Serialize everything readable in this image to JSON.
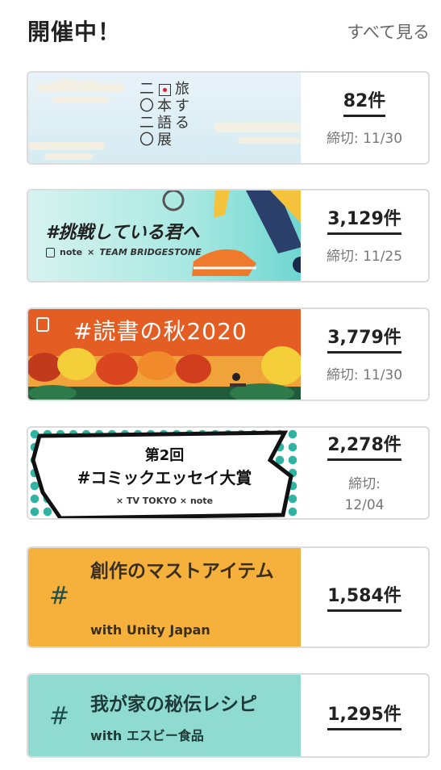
{
  "header": {
    "title": "開催中！",
    "see_all": "すべて見る"
  },
  "contests": [
    {
      "banner": {
        "grid": [
          [
            "二",
            "",
            "旅"
          ],
          [
            "〇",
            "本",
            "す"
          ],
          [
            "二",
            "語",
            "る"
          ],
          [
            "〇",
            "展",
            ""
          ]
        ]
      },
      "count": "82件",
      "deadline": "締切: 11/30"
    },
    {
      "banner": {
        "hashtag": "#挑戦している君へ",
        "logo_note": "note",
        "cross": "×",
        "partner": "TEAM BRIDGESTONE"
      },
      "count": "3,129件",
      "deadline": "締切: 11/25"
    },
    {
      "banner": {
        "hashtag": "#読書の秋2020"
      },
      "count": "3,779件",
      "deadline": "締切: 11/30"
    },
    {
      "banner": {
        "line1": "第2回",
        "line2": "#コミックエッセイ大賞",
        "logos": "×  TV TOKYO  ×  note"
      },
      "count": "2,278件",
      "deadline_label": "締切:",
      "deadline_date": "12/04"
    },
    {
      "banner": {
        "hash": "#",
        "title": "創作のマストアイテム",
        "subtitle": "with Unity Japan",
        "bg": "#f5b13c"
      },
      "count": "1,584件"
    },
    {
      "banner": {
        "hash": "#",
        "title": "我が家の秘伝レシピ",
        "subtitle": "with エスビー食品",
        "bg": "#8fdbd1"
      },
      "count": "1,295件"
    }
  ]
}
